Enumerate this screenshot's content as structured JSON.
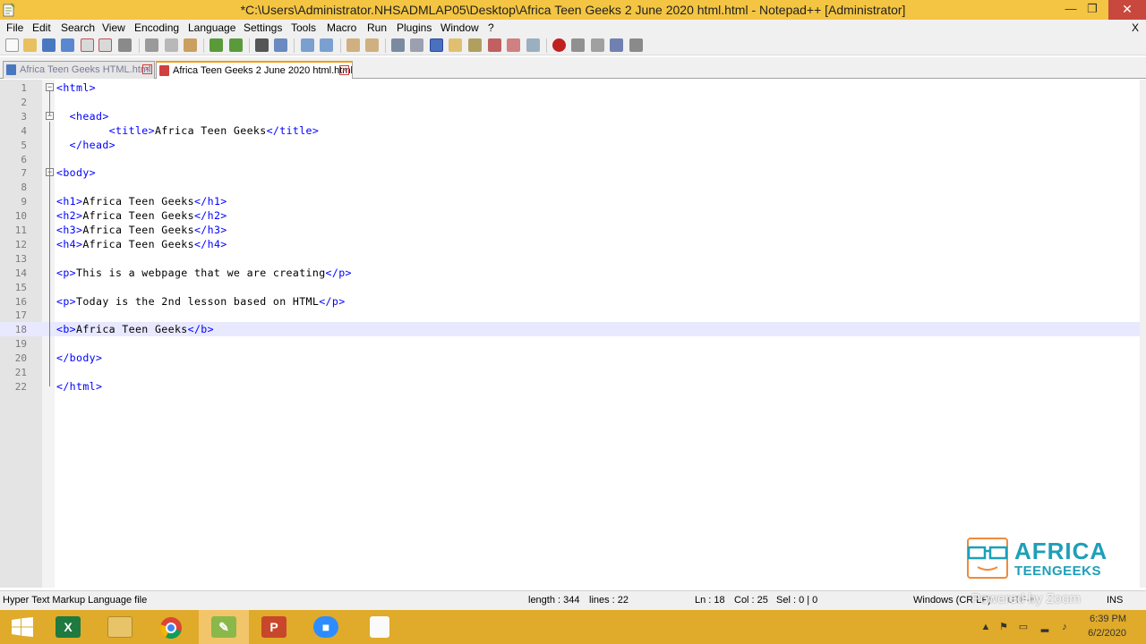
{
  "window": {
    "title": "*C:\\Users\\Administrator.NHSADMLAP05\\Desktop\\Africa Teen Geeks 2 June 2020 html.html - Notepad++ [Administrator]",
    "minimize": "—",
    "maximize": "❐",
    "close": "✕"
  },
  "menu": {
    "items": [
      "File",
      "Edit",
      "Search",
      "View",
      "Encoding",
      "Language",
      "Settings",
      "Tools",
      "Macro",
      "Run",
      "Plugins",
      "Window",
      "?"
    ],
    "close_x": "X"
  },
  "tabs": [
    {
      "label": "Africa Teen Geeks HTML.html",
      "close": "×"
    },
    {
      "label": "Africa Teen Geeks 2 June 2020 html.html",
      "close": "×"
    }
  ],
  "editor": {
    "current_line": 18,
    "lines": [
      {
        "n": "1",
        "text": "<html>"
      },
      {
        "n": "2",
        "text": ""
      },
      {
        "n": "3",
        "text": "  <head>"
      },
      {
        "n": "4",
        "text": "        <title>Africa Teen Geeks</title>"
      },
      {
        "n": "5",
        "text": "  </head>"
      },
      {
        "n": "6",
        "text": ""
      },
      {
        "n": "7",
        "text": "<body>"
      },
      {
        "n": "8",
        "text": ""
      },
      {
        "n": "9",
        "text": "<h1>Africa Teen Geeks</h1>"
      },
      {
        "n": "10",
        "text": "<h2>Africa Teen Geeks</h2>"
      },
      {
        "n": "11",
        "text": "<h3>Africa Teen Geeks</h3>"
      },
      {
        "n": "12",
        "text": "<h4>Africa Teen Geeks</h4>"
      },
      {
        "n": "13",
        "text": ""
      },
      {
        "n": "14",
        "text": "<p>This is a webpage that we are creating</p>"
      },
      {
        "n": "15",
        "text": ""
      },
      {
        "n": "16",
        "text": "<p>Today is the 2nd lesson based on HTML</p>"
      },
      {
        "n": "17",
        "text": ""
      },
      {
        "n": "18",
        "text": "<b>Africa Teen Geeks</b>"
      },
      {
        "n": "19",
        "text": ""
      },
      {
        "n": "20",
        "text": "</body>"
      },
      {
        "n": "21",
        "text": ""
      },
      {
        "n": "22",
        "text": "</html>"
      }
    ]
  },
  "logo": {
    "line1": "AFRICA",
    "line2": "TEENGEEKS"
  },
  "status": {
    "file_type": "Hyper Text Markup Language file",
    "length": "length : 344",
    "lines": "lines : 22",
    "ln": "Ln : 18",
    "col": "Col : 25",
    "sel": "Sel : 0 | 0",
    "eol": "Windows (CR LF)",
    "encoding": "UTF-8",
    "mode": "INS",
    "watermark": "Powered by Zoom"
  },
  "taskbar": {
    "apps": [
      "start",
      "excel",
      "file-explorer",
      "chrome",
      "notepad++",
      "powerpoint",
      "zoom",
      "acrobat"
    ],
    "clock_time": "6:39 PM",
    "clock_date": "6/2/2020"
  },
  "colors": {
    "titlebar": "#f4c542",
    "taskbar": "#e0aa2a",
    "tag_blue": "#0000ff",
    "logo_teal": "#1e9fb8"
  }
}
